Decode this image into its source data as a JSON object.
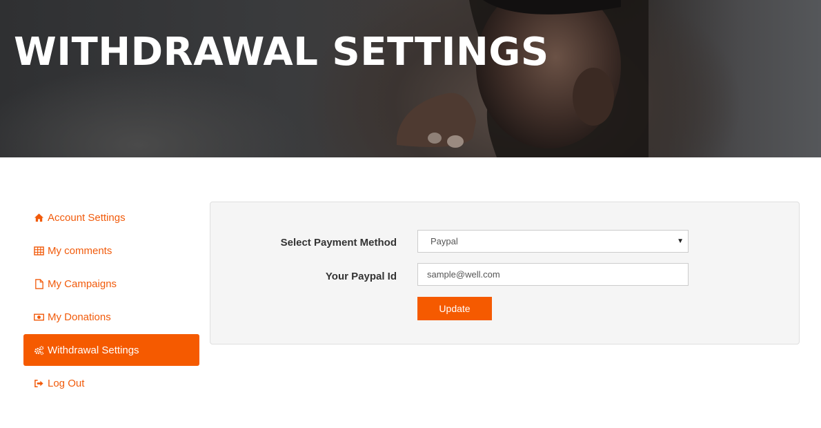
{
  "hero": {
    "title": "WITHDRAWAL SETTINGS"
  },
  "sidebar": {
    "items": [
      {
        "label": "Account Settings",
        "icon": "home-icon"
      },
      {
        "label": "My comments",
        "icon": "table-icon"
      },
      {
        "label": "My Campaigns",
        "icon": "file-icon"
      },
      {
        "label": "My Donations",
        "icon": "money-icon"
      },
      {
        "label": "Withdrawal Settings",
        "icon": "gears-icon",
        "active": true
      },
      {
        "label": "Log Out",
        "icon": "sign-out-icon"
      }
    ]
  },
  "form": {
    "payment_method_label": "Select Payment Method",
    "payment_method_value": "Paypal",
    "paypal_id_label": "Your Paypal Id",
    "paypal_id_value": "sample@well.com",
    "update_label": "Update"
  },
  "colors": {
    "accent": "#f55a00",
    "link": "#f15a0a",
    "panel_bg": "#f5f5f5"
  }
}
